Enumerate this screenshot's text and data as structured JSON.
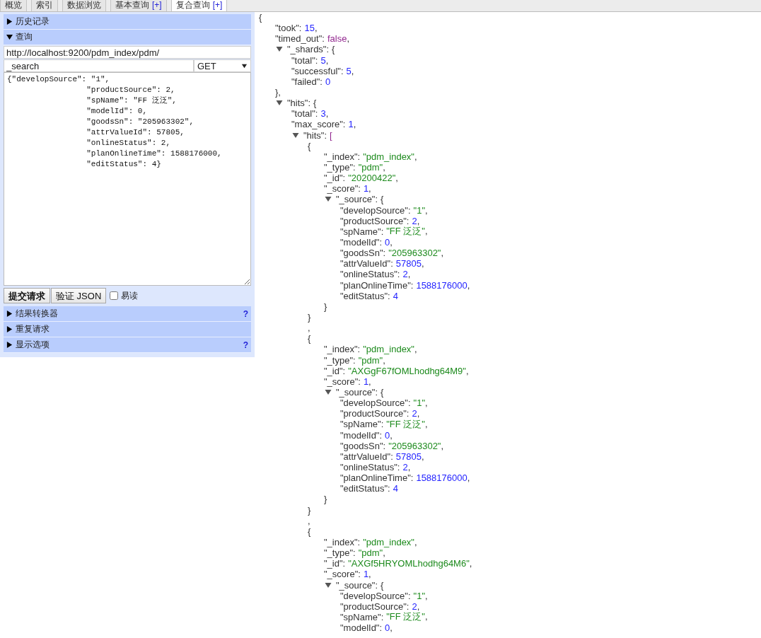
{
  "tabs": [
    {
      "label": "概览",
      "selected": false
    },
    {
      "label": "索引",
      "selected": false
    },
    {
      "label": "数据浏览",
      "selected": false
    },
    {
      "label": "基本查询",
      "extra": "[+]",
      "selected": false
    },
    {
      "label": "复合查询",
      "extra": "[+]",
      "selected": true
    }
  ],
  "panel": {
    "sections_top": [
      {
        "title": "历史记录",
        "expanded": false
      },
      {
        "title": "查询",
        "expanded": true
      }
    ],
    "query": {
      "url": "http://localhost:9200/pdm_index/pdm/",
      "path": "_search",
      "method": "GET",
      "body": "{\"developSource\": \"1\",\n                 \"productSource\": 2,\n                 \"spName\": \"FF 泛泛\",\n                 \"modelId\": 0,\n                 \"goodsSn\": \"205963302\",\n                 \"attrValueId\": 57805,\n                 \"onlineStatus\": 2,\n                 \"planOnlineTime\": 1588176000,\n                 \"editStatus\": 4}",
      "buttons": [
        {
          "label": "提交请求",
          "kind": "primary"
        },
        {
          "label": "验证 JSON",
          "kind": "normal"
        }
      ],
      "pretty": {
        "label": "易读",
        "checked": false
      }
    },
    "sections_bottom": [
      {
        "title": "结果转换器",
        "expanded": false,
        "help": "?"
      },
      {
        "title": "重复请求",
        "expanded": false
      },
      {
        "title": "显示选项",
        "expanded": false,
        "help": "?"
      }
    ]
  },
  "result": {
    "kind": "object",
    "open": "{",
    "children": [
      {
        "kind": "number",
        "key": "\"took\":",
        "value": "15",
        "comma": ","
      },
      {
        "kind": "boolean",
        "key": "\"timed_out\":",
        "value": "false",
        "comma": ","
      },
      {
        "kind": "object",
        "key": "\"_shards\":",
        "open": "{",
        "expanded": true,
        "close": "},",
        "children": [
          {
            "kind": "number",
            "key": "\"total\":",
            "value": "5",
            "comma": ","
          },
          {
            "kind": "number",
            "key": "\"successful\":",
            "value": "5",
            "comma": ","
          },
          {
            "kind": "number",
            "key": "\"failed\":",
            "value": "0"
          }
        ]
      },
      {
        "kind": "object",
        "key": "\"hits\":",
        "open": "{",
        "expanded": true,
        "children": [
          {
            "kind": "number",
            "key": "\"total\":",
            "value": "3",
            "comma": ","
          },
          {
            "kind": "number",
            "key": "\"max_score\":",
            "value": "1",
            "comma": ","
          },
          {
            "kind": "array",
            "key": "\"hits\":",
            "open": "[",
            "expanded": true,
            "children": [
              {
                "kind": "object",
                "open": "{",
                "close": "}",
                "children": [
                  {
                    "kind": "string",
                    "key": "\"_index\":",
                    "value": "\"pdm_index\"",
                    "comma": ","
                  },
                  {
                    "kind": "string",
                    "key": "\"_type\":",
                    "value": "\"pdm\"",
                    "comma": ","
                  },
                  {
                    "kind": "string",
                    "key": "\"_id\":",
                    "value": "\"20200422\"",
                    "comma": ","
                  },
                  {
                    "kind": "number",
                    "key": "\"_score\":",
                    "value": "1",
                    "comma": ","
                  },
                  {
                    "kind": "object",
                    "key": "\"_source\":",
                    "open": "{",
                    "expanded": true,
                    "close": "}",
                    "children": [
                      {
                        "kind": "string",
                        "key": "\"developSource\":",
                        "value": "\"1\"",
                        "comma": ","
                      },
                      {
                        "kind": "number",
                        "key": "\"productSource\":",
                        "value": "2",
                        "comma": ","
                      },
                      {
                        "kind": "string",
                        "key": "\"spName\":",
                        "value": "\"FF 泛泛\"",
                        "comma": ","
                      },
                      {
                        "kind": "number",
                        "key": "\"modelId\":",
                        "value": "0",
                        "comma": ","
                      },
                      {
                        "kind": "string",
                        "key": "\"goodsSn\":",
                        "value": "\"205963302\"",
                        "comma": ","
                      },
                      {
                        "kind": "number",
                        "key": "\"attrValueId\":",
                        "value": "57805",
                        "comma": ","
                      },
                      {
                        "kind": "number",
                        "key": "\"onlineStatus\":",
                        "value": "2",
                        "comma": ","
                      },
                      {
                        "kind": "number",
                        "key": "\"planOnlineTime\":",
                        "value": "1588176000",
                        "comma": ","
                      },
                      {
                        "kind": "number",
                        "key": "\"editStatus\":",
                        "value": "4"
                      }
                    ]
                  }
                ]
              },
              {
                "kind": "separator",
                "text": ","
              },
              {
                "kind": "object",
                "open": "{",
                "close": "}",
                "children": [
                  {
                    "kind": "string",
                    "key": "\"_index\":",
                    "value": "\"pdm_index\"",
                    "comma": ","
                  },
                  {
                    "kind": "string",
                    "key": "\"_type\":",
                    "value": "\"pdm\"",
                    "comma": ","
                  },
                  {
                    "kind": "string",
                    "key": "\"_id\":",
                    "value": "\"AXGgF67fOMLhodhg64M9\"",
                    "comma": ","
                  },
                  {
                    "kind": "number",
                    "key": "\"_score\":",
                    "value": "1",
                    "comma": ","
                  },
                  {
                    "kind": "object",
                    "key": "\"_source\":",
                    "open": "{",
                    "expanded": true,
                    "close": "}",
                    "children": [
                      {
                        "kind": "string",
                        "key": "\"developSource\":",
                        "value": "\"1\"",
                        "comma": ","
                      },
                      {
                        "kind": "number",
                        "key": "\"productSource\":",
                        "value": "2",
                        "comma": ","
                      },
                      {
                        "kind": "string",
                        "key": "\"spName\":",
                        "value": "\"FF 泛泛\"",
                        "comma": ","
                      },
                      {
                        "kind": "number",
                        "key": "\"modelId\":",
                        "value": "0",
                        "comma": ","
                      },
                      {
                        "kind": "string",
                        "key": "\"goodsSn\":",
                        "value": "\"205963302\"",
                        "comma": ","
                      },
                      {
                        "kind": "number",
                        "key": "\"attrValueId\":",
                        "value": "57805",
                        "comma": ","
                      },
                      {
                        "kind": "number",
                        "key": "\"onlineStatus\":",
                        "value": "2",
                        "comma": ","
                      },
                      {
                        "kind": "number",
                        "key": "\"planOnlineTime\":",
                        "value": "1588176000",
                        "comma": ","
                      },
                      {
                        "kind": "number",
                        "key": "\"editStatus\":",
                        "value": "4"
                      }
                    ]
                  }
                ]
              },
              {
                "kind": "separator",
                "text": ","
              },
              {
                "kind": "object",
                "open": "{",
                "children": [
                  {
                    "kind": "string",
                    "key": "\"_index\":",
                    "value": "\"pdm_index\"",
                    "comma": ","
                  },
                  {
                    "kind": "string",
                    "key": "\"_type\":",
                    "value": "\"pdm\"",
                    "comma": ","
                  },
                  {
                    "kind": "string",
                    "key": "\"_id\":",
                    "value": "\"AXGf5HRYOMLhodhg64M6\"",
                    "comma": ","
                  },
                  {
                    "kind": "number",
                    "key": "\"_score\":",
                    "value": "1",
                    "comma": ","
                  },
                  {
                    "kind": "object",
                    "key": "\"_source\":",
                    "open": "{",
                    "expanded": true,
                    "children": [
                      {
                        "kind": "string",
                        "key": "\"developSource\":",
                        "value": "\"1\"",
                        "comma": ","
                      },
                      {
                        "kind": "number",
                        "key": "\"productSource\":",
                        "value": "2",
                        "comma": ","
                      },
                      {
                        "kind": "string",
                        "key": "\"spName\":",
                        "value": "\"FF 泛泛\"",
                        "comma": ","
                      },
                      {
                        "kind": "number",
                        "key": "\"modelId\":",
                        "value": "0",
                        "comma": ","
                      }
                    ]
                  }
                ]
              }
            ]
          }
        ]
      }
    ]
  }
}
